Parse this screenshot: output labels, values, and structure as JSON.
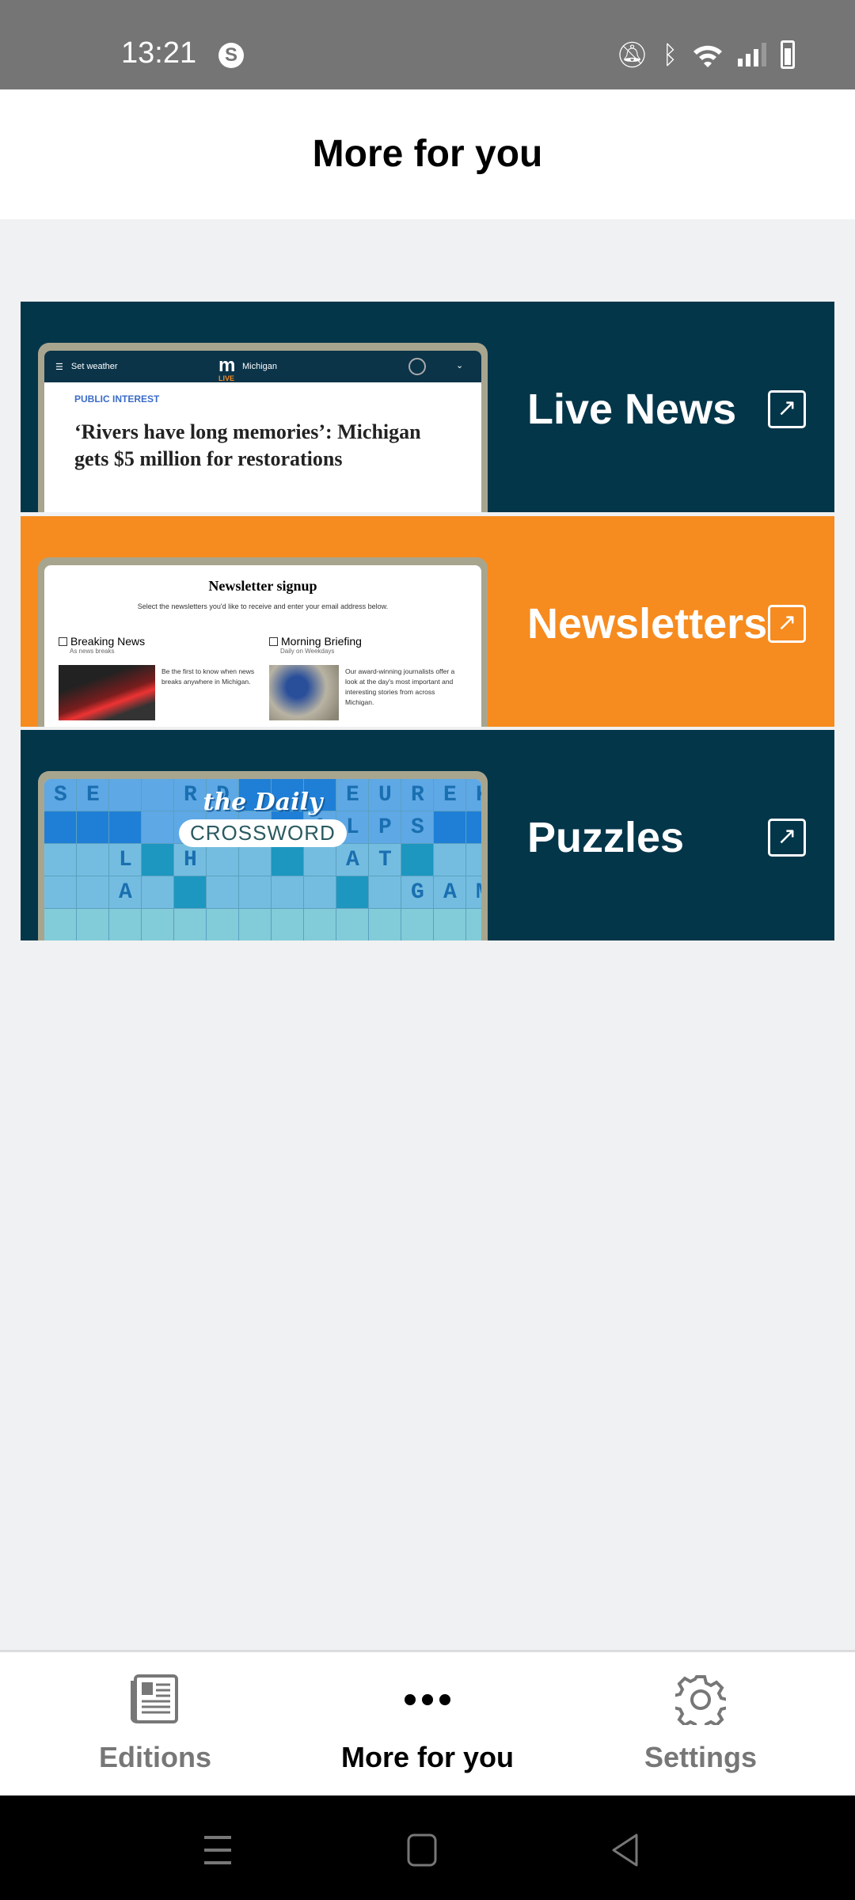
{
  "status_bar": {
    "time": "13:21",
    "icons": [
      "s-app-icon",
      "bell-off-icon",
      "bluetooth-icon",
      "wifi-icon",
      "signal-icon",
      "battery-icon"
    ]
  },
  "header": {
    "title": "More for you"
  },
  "cards": [
    {
      "label": "Live News",
      "color": "#04364a",
      "icon": "external-link-icon",
      "preview": {
        "menu": "Set weather",
        "logo": "m",
        "logo_sub": "LIVE",
        "region": "Michigan",
        "kicker": "PUBLIC INTEREST",
        "headline": "‘Rivers have long memories’: Michigan gets $5 million for restorations"
      }
    },
    {
      "label": "Newsletters",
      "color": "#f68b1f",
      "icon": "external-link-icon",
      "preview": {
        "title": "Newsletter signup",
        "subtitle": "Select the newsletters you'd like to receive and enter your email address below.",
        "items": [
          {
            "name": "Breaking News",
            "frequency": "As news breaks",
            "description": "Be the first to know when news breaks anywhere in Michigan."
          },
          {
            "name": "Morning Briefing",
            "frequency": "Daily on Weekdays",
            "description": "Our award-winning journalists offer a look at the day's most important and interesting stories from across Michigan."
          }
        ]
      }
    },
    {
      "label": "Puzzles",
      "color": "#04364a",
      "icon": "external-link-icon",
      "preview": {
        "logo_top": "the Daily",
        "logo_bottom": "CROSSWORD",
        "grid": [
          "SE  RD   EUREK",
          "        ALPS  ",
          "  L H    AT   ",
          "  A        GAM",
          "              "
        ],
        "dark": [
          [
            0,
            6
          ],
          [
            0,
            7
          ],
          [
            0,
            8
          ],
          [
            1,
            0
          ],
          [
            1,
            1
          ],
          [
            1,
            2
          ],
          [
            1,
            7
          ],
          [
            1,
            12
          ],
          [
            1,
            13
          ],
          [
            2,
            3
          ],
          [
            2,
            7
          ],
          [
            2,
            11
          ],
          [
            3,
            4
          ],
          [
            3,
            9
          ]
        ]
      }
    }
  ],
  "bottom_nav": {
    "tabs": [
      {
        "label": "Editions",
        "icon": "newspaper-icon",
        "active": false
      },
      {
        "label": "More for you",
        "icon": "more-dots-icon",
        "active": true
      },
      {
        "label": "Settings",
        "icon": "gear-icon",
        "active": false
      }
    ]
  },
  "system_nav": [
    "recents-icon",
    "home-icon",
    "back-icon"
  ]
}
